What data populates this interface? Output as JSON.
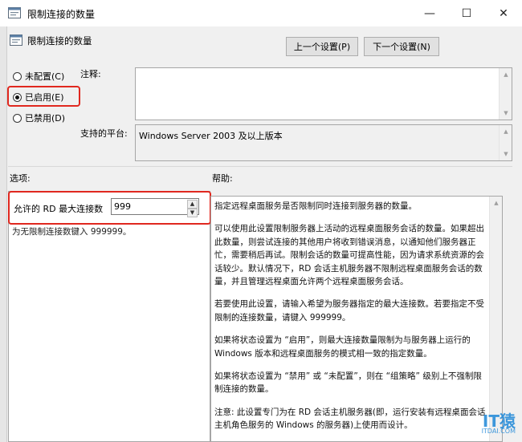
{
  "window": {
    "title": "限制连接的数量",
    "minimize": "—",
    "maximize": "☐",
    "close": "✕"
  },
  "policy": {
    "name": "限制连接的数量",
    "prev_button": "上一个设置(P)",
    "next_button": "下一个设置(N)"
  },
  "state": {
    "options": [
      {
        "label": "未配置(C)",
        "selected": false
      },
      {
        "label": "已启用(E)",
        "selected": true
      },
      {
        "label": "已禁用(D)",
        "selected": false
      }
    ]
  },
  "comment": {
    "label": "注释:",
    "value": ""
  },
  "platform": {
    "label": "支持的平台:",
    "value": "Windows Server 2003 及以上版本"
  },
  "options_section": {
    "label": "选项:",
    "field_label": "允许的 RD 最大连接数",
    "field_value": "999",
    "hint": "为无限制连接数键入 999999。"
  },
  "help_section": {
    "label": "帮助:",
    "paragraphs": [
      "指定远程桌面服务是否限制同时连接到服务器的数量。",
      "可以使用此设置限制服务器上活动的远程桌面服务会话的数量。如果超出此数量，则尝试连接的其他用户将收到错误消息，以通知他们服务器正忙，需要稍后再试。限制会话的数量可提高性能，因为请求系统资源的会话较少。默认情况下，RD 会话主机服务器不限制远程桌面服务会话的数量，并且管理远程桌面允许两个远程桌面服务会话。",
      "若要使用此设置，请输入希望为服务器指定的最大连接数。若要指定不受限制的连接数量，请键入 999999。",
      "如果将状态设置为 “启用”，则最大连接数量限制为与服务器上运行的 Windows 版本和远程桌面服务的模式相一致的指定数量。",
      "如果将状态设置为 “禁用” 或 “未配置”，则在 “组策略” 级别上不强制限制连接的数量。",
      "注意: 此设置专门为在 RD 会话主机服务器(即，运行安装有远程桌面会话主机角色服务的 Windows 的服务器)上使用而设计。"
    ]
  },
  "watermark": {
    "brand": "IT猿",
    "domain": "ITDAI.COM"
  },
  "colors": {
    "highlight_box": "#e0281f",
    "window_bg": "#f0f0f0"
  }
}
